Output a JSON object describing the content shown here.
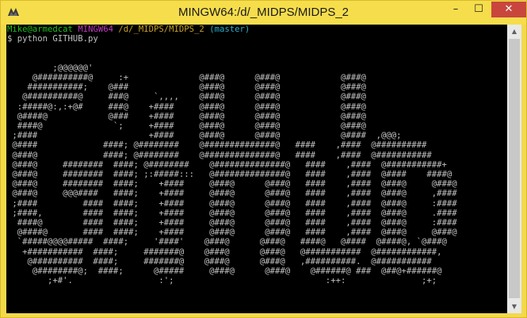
{
  "window": {
    "title": "MINGW64:/d/_MIDPS/MIDPS_2",
    "minimize_label": "–",
    "maximize_label": "☐",
    "close_label": "✕",
    "app_icon": "mingw-terminal-icon"
  },
  "terminal": {
    "prompt": {
      "user_host": "Mike@armedcat",
      "env": "MINGW64",
      "path": "/d/_MIDPS/MIDPS_2",
      "branch": "(master)"
    },
    "command": "$ python GITHUB.py",
    "art_lines": [
      "",
      "",
      "         ;@@@@@@'",
      "     @##########@     :+              @###@      @###@            @###@",
      "    ###########;    @###              @###@      @###@            @###@",
      "   @##########@     ###@     `,,,,    @###@      @###@            @###@",
      "  :#####@:,:+@#     ###@    +####     @###@      @###@            @###@",
      "  @####@            @###    +####     @###@      @###@            @###@",
      "  ####@              `;     +####     @###@      @###@            @###@",
      " ;####                      +####     @###@      @###@            @####  ,@@@;",
      " @####             ####; @########    @##############@   ####    ,####  @##########",
      " @###@             ####; @########    @##############@   ####    ,####  @###########",
      " @###@     ########  ####; @########    @##############@   ####    ,####  @###########+",
      " @###@     ########  ####; ;:#####:::   @##############@   ####    ,####  @####    ####@",
      " @###@     ########  ####;    +####     @###@      @###@   ####    ,####  @###@     @###@",
      " @###@     @@@####   ####;    +####     @###@      @###@   ####    ,####  @###@     ,####",
      " ;####         ####  ####;    +####     @###@      @###@   ####    ,####  @###@     :####",
      " ;####,        ####  ####;    +####     @###@      @###@   ####    ,####  @###@     .####",
      "  ####@        ####  ####;    +####     @###@      @###@   ####    ,####  @###@     :####",
      "  @####@       ####  ####;    +####     @###@      @###@   ####    ,####  @###@     @###@",
      "  `#####@@@@#####  ####;     '####'    @###@      @###@   ####@   @####  @####@, `@###@",
      "   +###########  ####;     #######@    @###@      @###@   @###########  @############,",
      "    @##########  ####;     #######@    @###@      @###@   ,##########.  @###########",
      "     @########@;  ####;      @#####     @###@      @###@    @######@ ###  @##@+######@",
      "        ;+#'.                 :';                              :++:               ;+;"
    ]
  }
}
